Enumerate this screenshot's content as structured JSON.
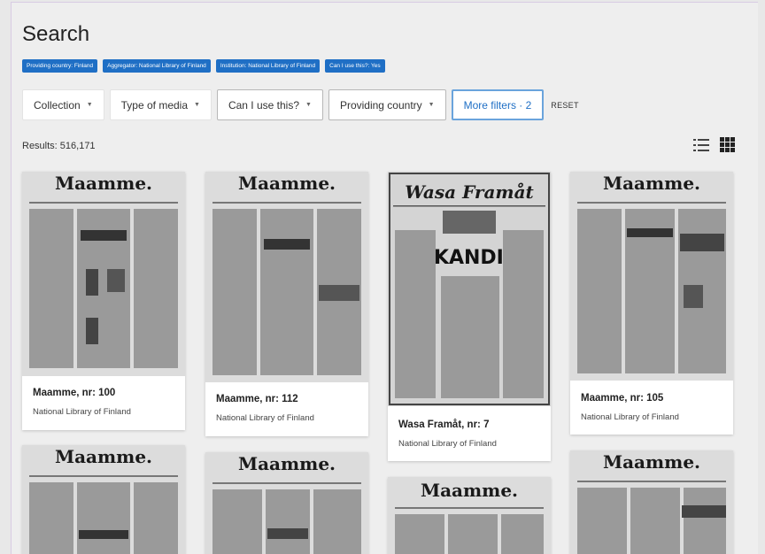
{
  "page": {
    "title": "Search"
  },
  "chips": [
    "Providing country: Finland",
    "Aggregator: National Library of Finland",
    "Institution: National Library of Finland",
    "Can I use this?: Yes"
  ],
  "filters": {
    "collection": "Collection",
    "type_of_media": "Type of media",
    "can_i_use_this": "Can I use this?",
    "providing_country": "Providing country",
    "more_filters": "More filters · 2",
    "reset": "RESET"
  },
  "results": {
    "label": "Results: 516,171"
  },
  "view": {
    "icons": [
      "list-view-icon",
      "grid-view-icon"
    ],
    "selected": "grid"
  },
  "colors": {
    "chip": "#1f6fc5",
    "accent": "#1f6fc5",
    "active_border": "#6aa4dc"
  },
  "cards": [
    {
      "title": "Maamme, nr: 100",
      "provider": "National Library of Finland",
      "masthead": "Maamme."
    },
    {
      "title": "Maamme, nr: 112",
      "provider": "National Library of Finland",
      "masthead": "Maamme."
    },
    {
      "title": "Wasa Framåt, nr: 7",
      "provider": "National Library of Finland",
      "masthead": "Wasa Framåt",
      "headline": "SKANDIA"
    },
    {
      "title": "Maamme, nr: 105",
      "provider": "National Library of Finland",
      "masthead": "Maamme."
    },
    {
      "masthead": "Maamme."
    },
    {
      "masthead": "Maamme."
    },
    {
      "masthead": "Maamme."
    },
    {
      "masthead": "Maamme."
    }
  ]
}
